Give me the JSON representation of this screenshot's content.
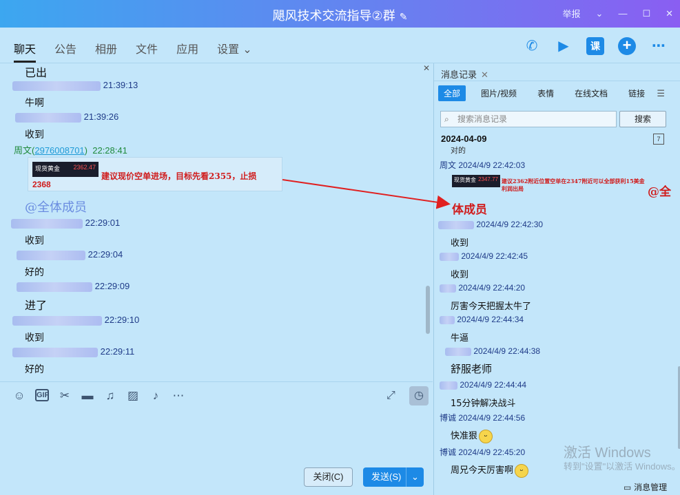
{
  "window": {
    "title": "飓风技术交流指导②群",
    "edit_icon": "✎",
    "report": "举报"
  },
  "nav": {
    "tabs": [
      "聊天",
      "公告",
      "相册",
      "文件",
      "应用",
      "设置"
    ],
    "settings_caret": "⌄"
  },
  "chat": {
    "line0_text": "已出",
    "m1": {
      "time": "21:39:13",
      "text": "牛啊"
    },
    "m2": {
      "time": "21:39:26",
      "text": "收到"
    },
    "m3": {
      "sender": "周文",
      "qq": "2976008701",
      "time": "22:28:41"
    },
    "card": {
      "ticker": "现货黄金",
      "price_right": "2362.47",
      "price": "2368",
      "advice": "建议现价空单进场，目标先看2355，止损"
    },
    "at_all": "@全体成员",
    "m4": {
      "time": "22:29:01",
      "text": "收到"
    },
    "m5": {
      "time": "22:29:04",
      "text": "好的"
    },
    "m6": {
      "time": "22:29:09",
      "text": "进了"
    },
    "m7": {
      "time": "22:29:10",
      "text": "收到"
    },
    "m8": {
      "time": "22:29:11",
      "text": "好的"
    }
  },
  "buttons": {
    "close": "关闭(C)",
    "send": "发送(S)"
  },
  "history": {
    "tab": "消息记录",
    "filters": [
      "全部",
      "图片/视频",
      "表情",
      "在线文档",
      "链接"
    ],
    "search_placeholder": "搜索消息记录",
    "search_btn": "搜索",
    "date": "2024-04-09",
    "partial": "对的",
    "r1": {
      "sender": "周文",
      "time": "2024/4/9 22:42:03"
    },
    "r_card": {
      "ticker": "现货黄金",
      "price_right": "2347.77",
      "advice": "建议2362附近位置空单在2347附近可以全部获利15美金利润出局",
      "at_a": "@全",
      "at_b": "体成员"
    },
    "r2": {
      "time": "2024/4/9 22:42:30",
      "text": "收到"
    },
    "r3": {
      "time": "2024/4/9 22:42:45",
      "text": "收到"
    },
    "r4": {
      "time": "2024/4/9 22:44:20",
      "text": "厉害今天把握太牛了"
    },
    "r5": {
      "time": "2024/4/9 22:44:34",
      "text": "牛逼"
    },
    "r6": {
      "time": "2024/4/9 22:44:38",
      "text": "舒服老师"
    },
    "r7": {
      "time": "2024/4/9 22:44:44",
      "text": "15分钟解决战斗"
    },
    "r8": {
      "sender": "博诚",
      "time": "2024/4/9 22:44:56",
      "text": "快准狠"
    },
    "r9": {
      "sender": "博诚",
      "time": "2024/4/9 22:45:20",
      "text": "周兄今天厉害啊"
    },
    "manage": "消息管理"
  },
  "watermark": {
    "line1": "激活 Windows",
    "line2": "转到\"设置\"以激活 Windows。"
  }
}
